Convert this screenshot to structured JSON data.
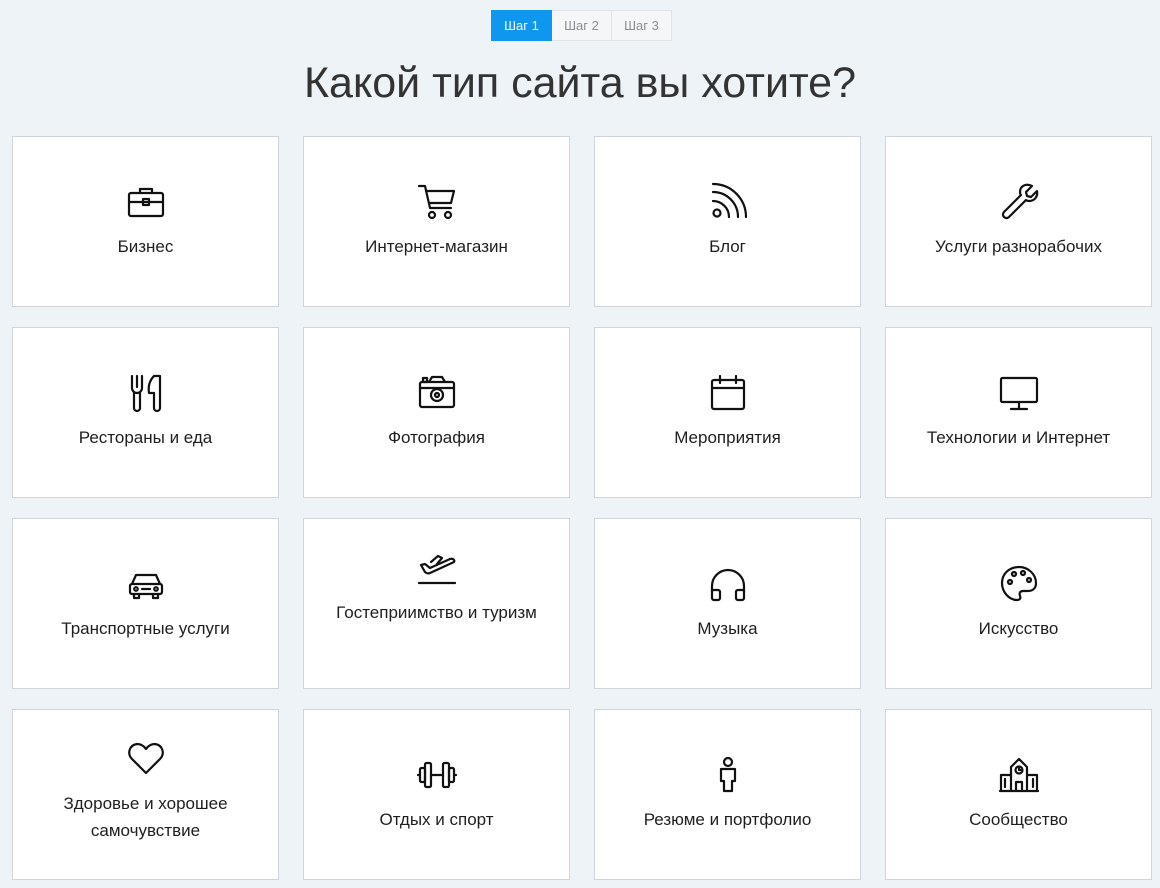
{
  "steps": [
    {
      "label": "Шаг 1",
      "active": true
    },
    {
      "label": "Шаг 2",
      "active": false
    },
    {
      "label": "Шаг 3",
      "active": false
    }
  ],
  "title": "Какой тип сайта вы хотите?",
  "accent_color": "#0f96ef",
  "categories": [
    {
      "label": "Бизнес",
      "icon": "briefcase-icon"
    },
    {
      "label": "Интернет-магазин",
      "icon": "shopping-cart-icon"
    },
    {
      "label": "Блог",
      "icon": "rss-icon"
    },
    {
      "label": "Услуги разнорабочих",
      "icon": "wrench-icon"
    },
    {
      "label": "Рестораны и еда",
      "icon": "fork-knife-icon"
    },
    {
      "label": "Фотография",
      "icon": "camera-icon"
    },
    {
      "label": "Мероприятия",
      "icon": "calendar-icon"
    },
    {
      "label": "Технологии и Интернет",
      "icon": "monitor-icon"
    },
    {
      "label": "Транспортные услуги",
      "icon": "car-icon"
    },
    {
      "label": "Гостеприимство и туризм",
      "icon": "airplane-icon"
    },
    {
      "label": "Музыка",
      "icon": "headphones-icon"
    },
    {
      "label": "Искусство",
      "icon": "palette-icon"
    },
    {
      "label": "Здоровье и хорошее самочувствие",
      "icon": "heart-icon"
    },
    {
      "label": "Отдых и спорт",
      "icon": "dumbbell-icon"
    },
    {
      "label": "Резюме и портфолио",
      "icon": "person-icon"
    },
    {
      "label": "Сообщество",
      "icon": "community-building-icon"
    }
  ]
}
